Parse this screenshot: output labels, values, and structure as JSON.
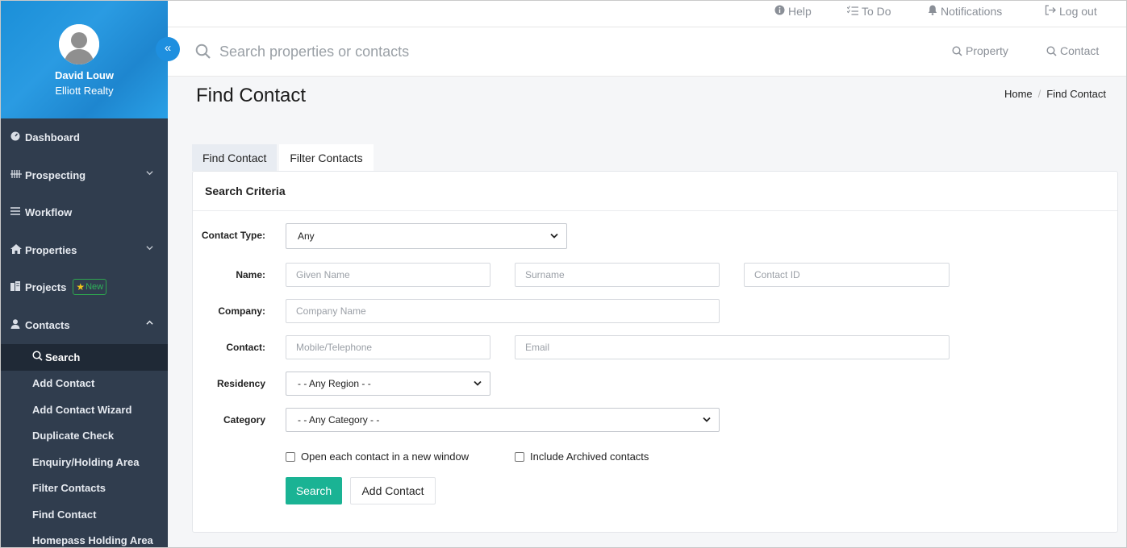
{
  "sidebar": {
    "user_name": "David Louw",
    "company": "Elliott Realty",
    "nav": [
      {
        "label": "Dashboard",
        "icon": "dashboard-icon"
      },
      {
        "label": "Prospecting",
        "icon": "prospecting-icon"
      },
      {
        "label": "Workflow",
        "icon": "workflow-icon"
      },
      {
        "label": "Properties",
        "icon": "home-icon"
      },
      {
        "label": "Projects",
        "icon": "building-icon",
        "badge": "New"
      },
      {
        "label": "Contacts",
        "icon": "user-icon"
      }
    ],
    "contacts_submenu": [
      {
        "label": "Search",
        "active": true
      },
      {
        "label": "Add Contact"
      },
      {
        "label": "Add Contact Wizard"
      },
      {
        "label": "Duplicate Check"
      },
      {
        "label": "Enquiry/Holding Area"
      },
      {
        "label": "Filter Contacts"
      },
      {
        "label": "Find Contact"
      },
      {
        "label": "Homepass Holding Area"
      }
    ]
  },
  "topbar": {
    "help": "Help",
    "todo": "To Do",
    "notifications": "Notifications",
    "logout": "Log out"
  },
  "search": {
    "placeholder": "Search properties or contacts",
    "property": "Property",
    "contact": "Contact"
  },
  "page": {
    "title": "Find Contact",
    "breadcrumb": [
      "Home",
      "Find Contact"
    ]
  },
  "tabs": [
    "Find Contact",
    "Filter Contacts"
  ],
  "form": {
    "header": "Search Criteria",
    "labels": {
      "contact_type": "Contact Type:",
      "name": "Name:",
      "company": "Company:",
      "contact": "Contact:",
      "residency": "Residency",
      "category": "Category"
    },
    "contact_type_value": "Any",
    "placeholders": {
      "given_name": "Given Name",
      "surname": "Surname",
      "contact_id": "Contact ID",
      "company_name": "Company Name",
      "mobile": "Mobile/Telephone",
      "email": "Email"
    },
    "residency_value": "- - Any Region - -",
    "category_value": "- - Any Category - -",
    "checkbox_new_window": "Open each contact in a new window",
    "checkbox_archived": "Include Archived contacts",
    "search_button": "Search",
    "add_contact_button": "Add Contact"
  },
  "colors": {
    "sidebar_bg": "#303d4e",
    "profile_bg": "#1e8fdf",
    "primary_button": "#1ab394",
    "badge_green": "#2ea44f"
  }
}
